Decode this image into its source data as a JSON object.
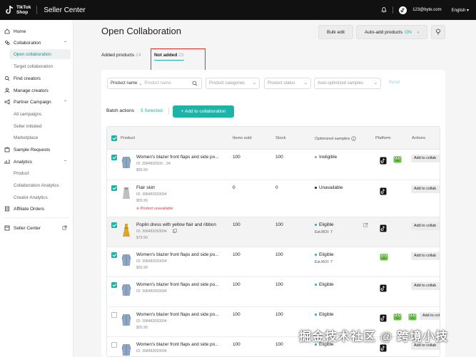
{
  "header": {
    "logo_line1": "TikTok",
    "logo_line2": "Shop",
    "title": "Seller Center",
    "user_email": "123@byte.com",
    "language": "English"
  },
  "sidebar": {
    "items": [
      {
        "label": "Home",
        "icon": "home-icon"
      },
      {
        "label": "Collaboration",
        "icon": "collaboration-icon"
      },
      {
        "label": "Open collaboration"
      },
      {
        "label": "Target collaboration"
      },
      {
        "label": "Find creators",
        "icon": "find-creators-icon"
      },
      {
        "label": "Manage creators",
        "icon": "manage-creators-icon"
      },
      {
        "label": "Partner Campaign",
        "icon": "campaign-icon"
      },
      {
        "label": "All campaigns"
      },
      {
        "label": "Seller initiated"
      },
      {
        "label": "Marketplace"
      },
      {
        "label": "Sample Requests",
        "icon": "sample-icon"
      },
      {
        "label": "Analytics",
        "icon": "analytics-icon"
      },
      {
        "label": "Product"
      },
      {
        "label": "Collaboration Analytics"
      },
      {
        "label": "Creator Analytics"
      },
      {
        "label": "Affiliate Orders",
        "icon": "orders-icon"
      },
      {
        "label": "Seller Center",
        "icon": "seller-center-icon"
      }
    ]
  },
  "main": {
    "title": "Open Collaboration",
    "bulk_edit": "Bulk edit",
    "auto_add": "Auto-add products",
    "auto_add_state": "ON",
    "tabs": [
      {
        "label": "Added products",
        "count": "24"
      },
      {
        "label": "Not added",
        "count": "23"
      }
    ],
    "filters": {
      "product_name_select": "Product name",
      "product_name_placeholder": "Product name",
      "product_categories": "Product categories",
      "product_status": "Product status",
      "auto_optimized": "Auto-optimized samples",
      "reset": "Reset"
    },
    "batch_actions": "Batch actions",
    "selected": "5 Selected",
    "add_to_collab": "+ Add to collaboration"
  },
  "table": {
    "headers": {
      "product": "Product",
      "items_sold": "Items sold",
      "stock": "Stock",
      "optimized": "Optimized samples",
      "platform": "Platform",
      "actions": "Actions"
    },
    "rows": [
      {
        "name": "Women's blazer front flaps and side po...",
        "id": "ID: 3984820930…94",
        "price": "$55.99",
        "sold": "100",
        "stock": "100",
        "status": "Ineligible",
        "status_color": "#999999",
        "roi": "",
        "unavailable": "",
        "checked": true,
        "action": "Add to collab",
        "platforms": 2
      },
      {
        "name": "Flair skirt",
        "id": "ID: 398482093094",
        "price": "$55.99",
        "sold": "0",
        "stock": "0",
        "status": "Unavailable",
        "status_color": "#222222",
        "roi": "",
        "unavailable": "Product unavailable",
        "checked": true,
        "action": "Add to collab",
        "platforms": 1
      },
      {
        "name": "Poplin dress with yellow flair and ribbon",
        "id": "ID: 398482093094",
        "price": "$79.99",
        "sold": "100",
        "stock": "100",
        "status": "Eligible",
        "status_color": "#1fb3a7",
        "roi": "Est.ROI: 7",
        "unavailable": "",
        "checked": true,
        "action": "Add to collab",
        "platforms": 1
      },
      {
        "name": "Women's blazer front flaps and side po...",
        "id": "ID: 398482093094",
        "price": "$55.99",
        "sold": "100",
        "stock": "100",
        "status": "Eligible",
        "status_color": "#1fb3a7",
        "roi": "Est.ROI: 7",
        "unavailable": "",
        "checked": true,
        "action": "Add to collab",
        "platforms": 0
      },
      {
        "name": "Women's blazer front flaps and side po...",
        "id": "ID: 398482093094",
        "price": "",
        "sold": "100",
        "stock": "100",
        "status": "Eligible",
        "status_color": "#1fb3a7",
        "roi": "",
        "unavailable": "",
        "checked": true,
        "action": "Add to collab",
        "platforms": 1
      },
      {
        "name": "Women's blazer front flaps and side po...",
        "id": "ID: 398482093094",
        "price": "$55.99",
        "sold": "100",
        "stock": "100",
        "status": "Eligible",
        "status_color": "#1fb3a7",
        "roi": "",
        "unavailable": "",
        "checked": false,
        "action": "Add to collab",
        "platforms": 3
      },
      {
        "name": "Women's blazer front flaps and side po...",
        "id": "ID: 398482093094",
        "price": "",
        "sold": "100",
        "stock": "100",
        "status": "Eligible",
        "status_color": "#1fb3a7",
        "roi": "",
        "unavailable": "",
        "checked": false,
        "action": "Add to collab",
        "platforms": 1
      }
    ]
  },
  "watermark": "掘金技术社区 @ 跨境小技",
  "colors": {
    "accent": "#1fb3a7",
    "danger": "#e0322f"
  }
}
